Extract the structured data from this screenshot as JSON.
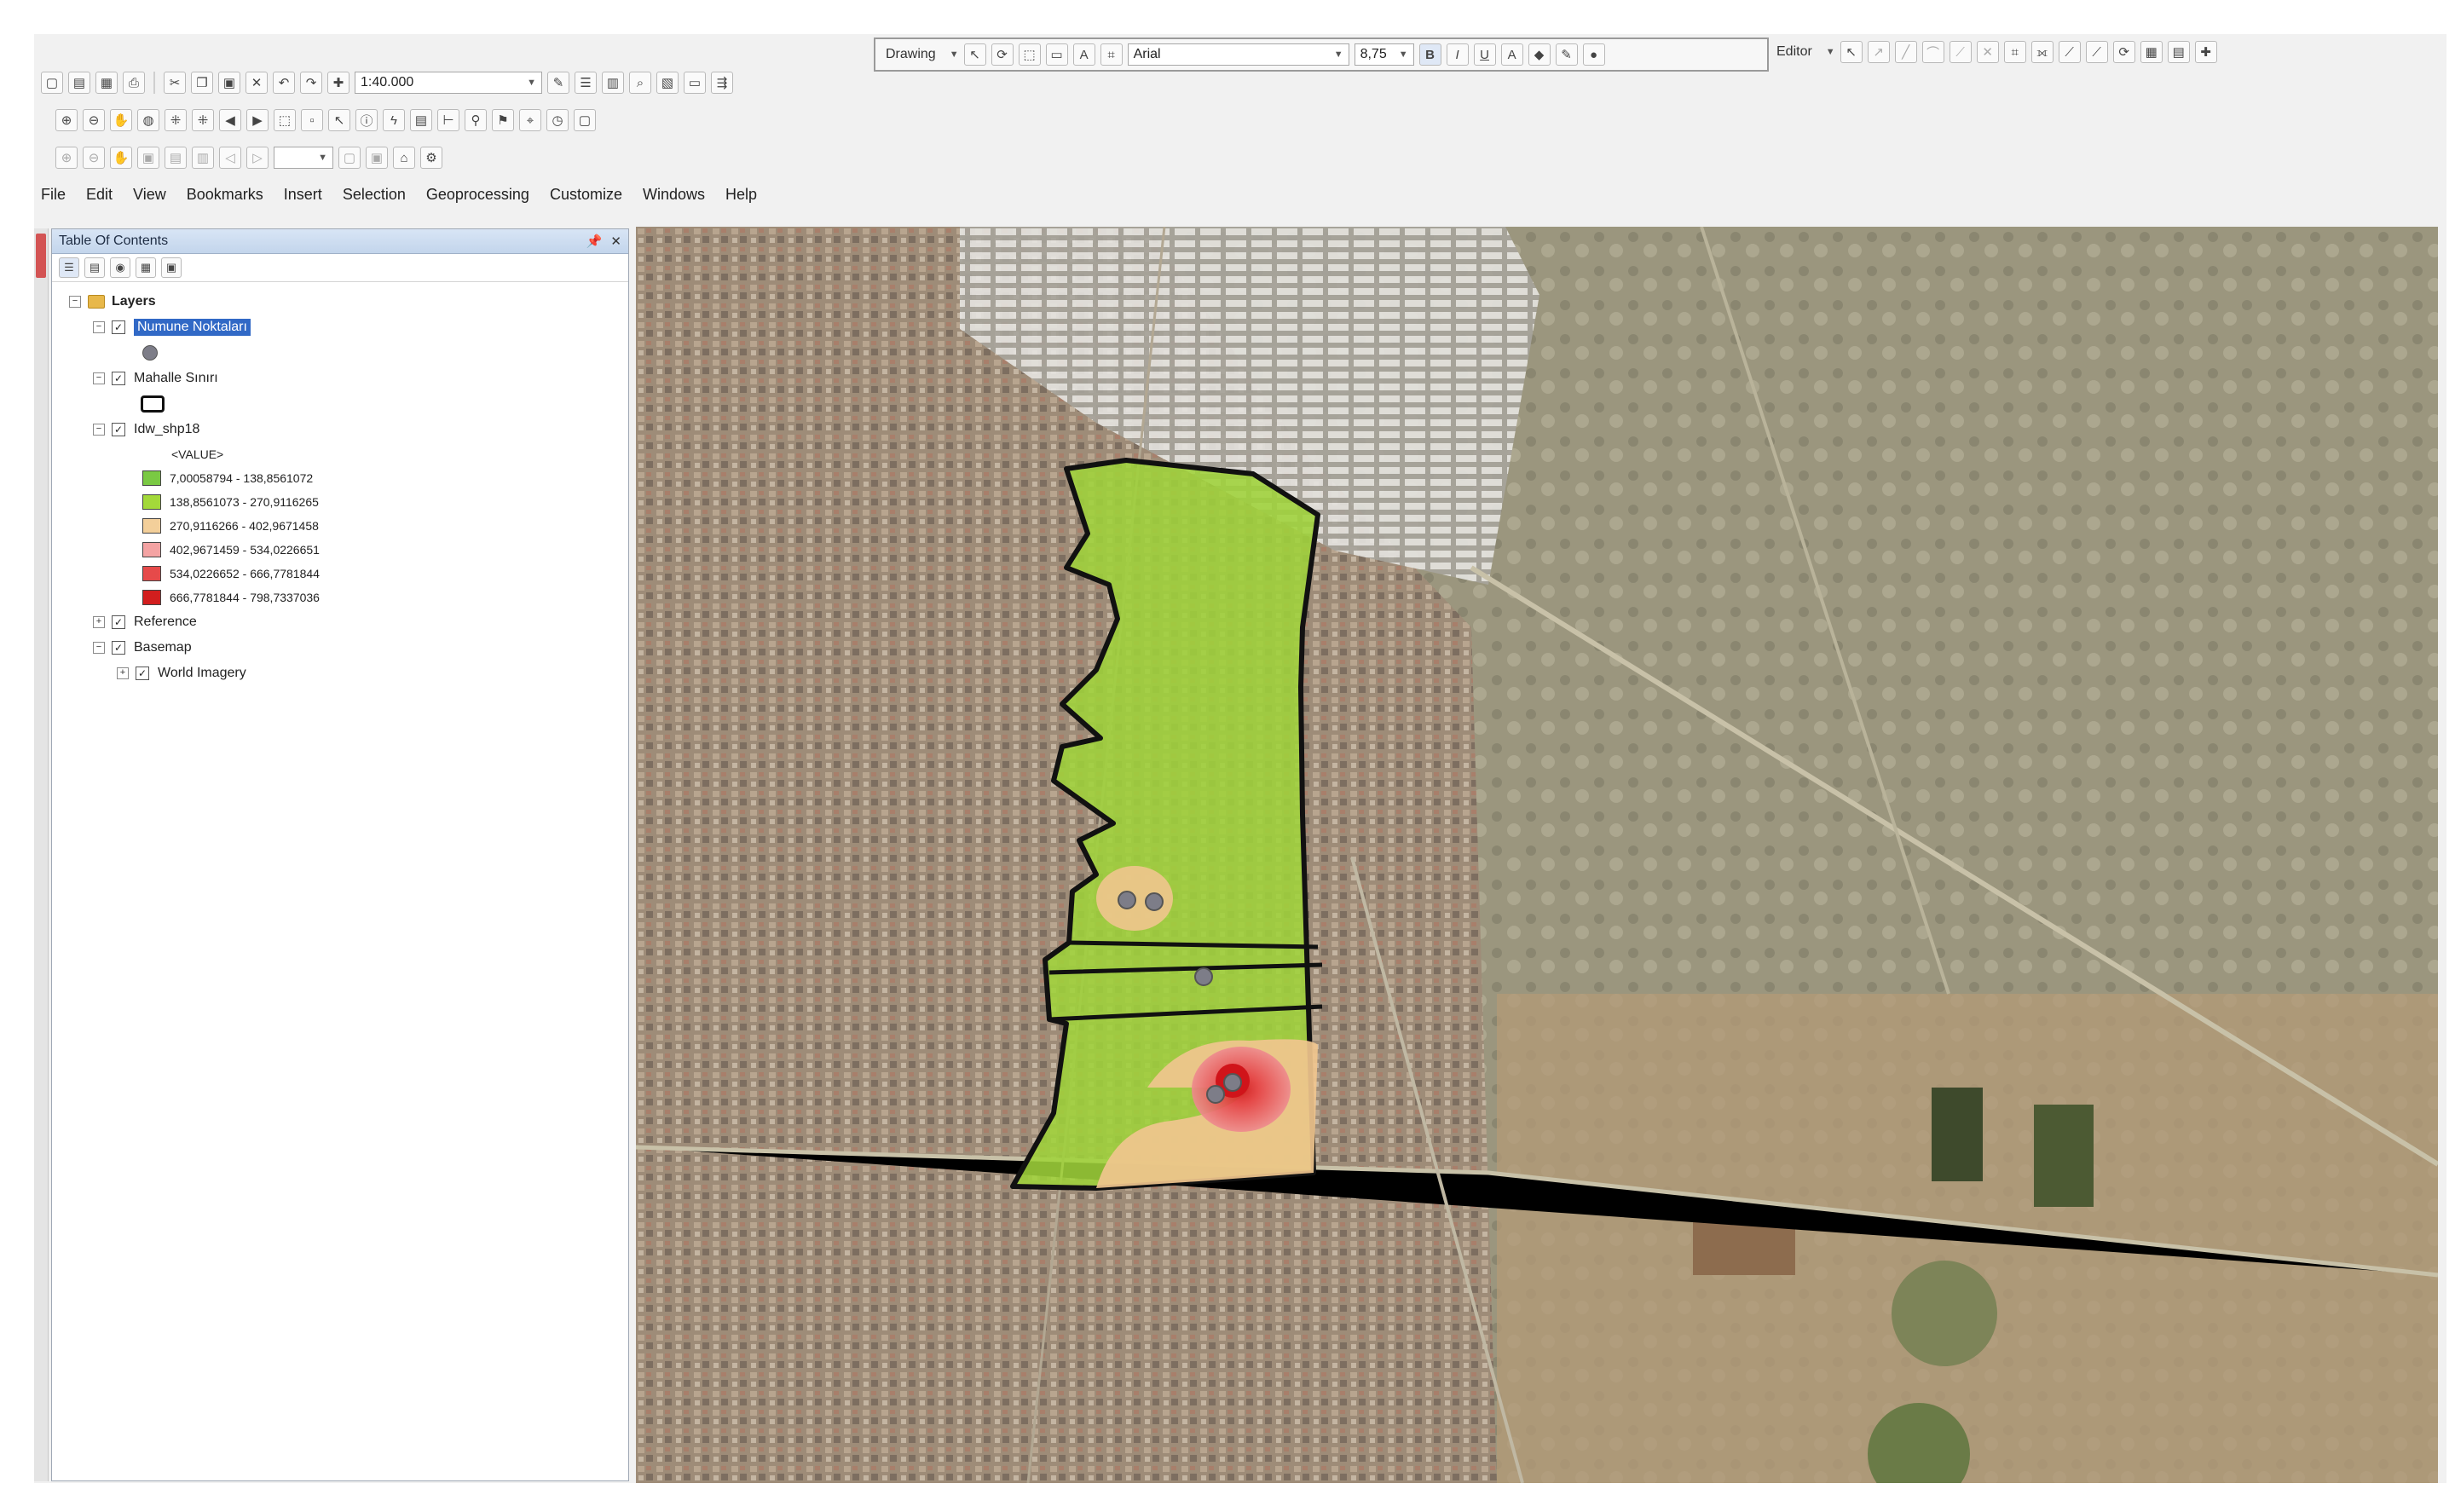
{
  "menu": [
    "File",
    "Edit",
    "View",
    "Bookmarks",
    "Insert",
    "Selection",
    "Geoprocessing",
    "Customize",
    "Windows",
    "Help"
  ],
  "standard_toolbar": {
    "scale": "1:40.000"
  },
  "drawing_toolbar": {
    "label": "Drawing",
    "font": "Arial",
    "size": "8,75",
    "bold": "B",
    "italic": "I",
    "underline": "U"
  },
  "editor_toolbar": {
    "label": "Editor"
  },
  "toc": {
    "title": "Table Of Contents",
    "layers_root": "Layers",
    "layers": [
      {
        "name": "Numune Noktaları",
        "checked": true,
        "selected": true,
        "symbol": "gray-point"
      },
      {
        "name": "Mahalle Sınırı",
        "checked": true,
        "symbol": "black-outline-polygon"
      },
      {
        "name": "Idw_shp18",
        "checked": true,
        "value_header": "<VALUE>",
        "classes": [
          {
            "label": "7,00058794 - 138,8561072",
            "color": "#7ac943"
          },
          {
            "label": "138,8561073 - 270,9116265",
            "color": "#a3d93a"
          },
          {
            "label": "270,9116266 - 402,9671458",
            "color": "#f3cf9a"
          },
          {
            "label": "402,9671459 - 534,0226651",
            "color": "#f4a3a3"
          },
          {
            "label": "534,0226652 - 666,7781844",
            "color": "#e64a4a"
          },
          {
            "label": "666,7781844 - 798,7337036",
            "color": "#d21e1e"
          }
        ]
      },
      {
        "name": "Reference",
        "checked": true
      },
      {
        "name": "Basemap",
        "checked": true,
        "children": [
          "World Imagery"
        ]
      }
    ]
  },
  "map": {
    "basemap": "World Imagery",
    "colors": {
      "study_area": "#9fd33a",
      "medium_zone": "#f0c58e",
      "high_zone": "#e9666b",
      "peak_zone": "#d0141a",
      "boundary": "#111111",
      "sample_point": "#7d7d88"
    }
  }
}
